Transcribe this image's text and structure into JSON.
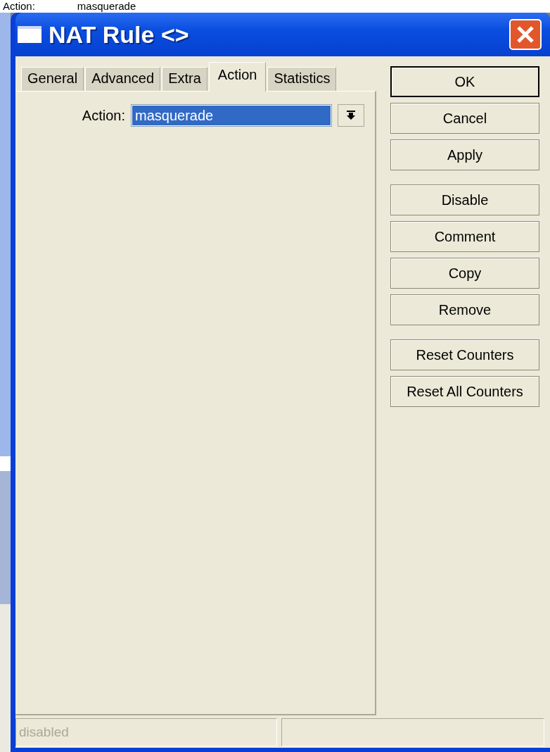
{
  "caption": {
    "label": "Action:",
    "value": "masquerade"
  },
  "window": {
    "title": "NAT Rule <>"
  },
  "tabs": [
    {
      "label": "General",
      "selected": false
    },
    {
      "label": "Advanced",
      "selected": false
    },
    {
      "label": "Extra",
      "selected": false
    },
    {
      "label": "Action",
      "selected": true
    },
    {
      "label": "Statistics",
      "selected": false
    }
  ],
  "form": {
    "label": "Action:",
    "value": "masquerade"
  },
  "button_groups": [
    [
      {
        "label": "OK",
        "default": true
      },
      {
        "label": "Cancel",
        "default": false
      },
      {
        "label": "Apply",
        "default": false
      }
    ],
    [
      {
        "label": "Disable",
        "default": false
      },
      {
        "label": "Comment",
        "default": false
      },
      {
        "label": "Copy",
        "default": false
      },
      {
        "label": "Remove",
        "default": false
      }
    ],
    [
      {
        "label": "Reset Counters",
        "default": false
      },
      {
        "label": "Reset All Counters",
        "default": false
      }
    ]
  ],
  "status_bar": {
    "left": "disabled"
  }
}
